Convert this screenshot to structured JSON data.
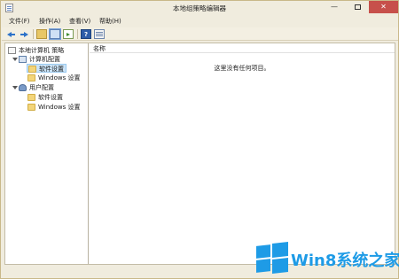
{
  "window": {
    "title": "本地组策略编辑器",
    "close_glyph": "✕",
    "minimize_glyph": "—"
  },
  "menu": {
    "items": [
      {
        "label": "文件(F)"
      },
      {
        "label": "操作(A)"
      },
      {
        "label": "查看(V)"
      },
      {
        "label": "帮助(H)"
      }
    ]
  },
  "toolbar": {
    "buttons": [
      "back-icon",
      "forward-icon",
      "up-folder-icon",
      "show-hide-tree-icon",
      "export-list-icon",
      "help-icon",
      "properties-icon"
    ],
    "help_glyph": "?"
  },
  "tree": {
    "root": "本地计算机 策略",
    "computer_config": "计算机配置",
    "software_settings_1": "软件设置",
    "windows_settings_1": "Windows 设置",
    "user_config": "用户配置",
    "software_settings_2": "软件设置",
    "windows_settings_2": "Windows 设置"
  },
  "list": {
    "column_name": "名称",
    "empty_message": "这里没有任何项目。"
  },
  "watermark": {
    "text": "Win8系统之家"
  },
  "colors": {
    "title_bg": "#f0ecde",
    "close_button": "#c7504b",
    "selection": "#cce4f7",
    "watermark": "#1e9be6"
  }
}
